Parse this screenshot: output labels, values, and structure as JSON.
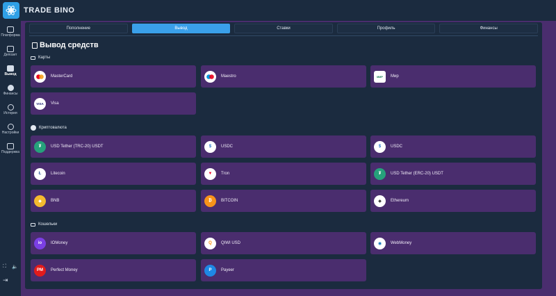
{
  "app": {
    "brand": "TRADE BINO"
  },
  "sidebar": {
    "items": [
      {
        "label": "Платформа"
      },
      {
        "label": "Депозит"
      },
      {
        "label": "Вывод"
      },
      {
        "label": "Финансы"
      },
      {
        "label": "История"
      },
      {
        "label": "Настройки"
      },
      {
        "label": "Поддержка"
      }
    ]
  },
  "tabs": [
    {
      "label": "Пополнение"
    },
    {
      "label": "Вывод"
    },
    {
      "label": "Ставки"
    },
    {
      "label": "Профиль"
    },
    {
      "label": "Финансы"
    }
  ],
  "page": {
    "title": "Вывод средств"
  },
  "sections": {
    "cards": {
      "title": "Карты",
      "items": [
        {
          "label": "MasterCard",
          "icon": "mastercard-icon"
        },
        {
          "label": "Maestro",
          "icon": "maestro-icon"
        },
        {
          "label": "Мир",
          "icon": "mir-icon"
        },
        {
          "label": "Visa",
          "icon": "visa-icon"
        }
      ]
    },
    "crypto": {
      "title": "Криптовалюта",
      "items": [
        {
          "label": "USD Tether (TRC-20) USDT",
          "icon": "tether-trc20-icon"
        },
        {
          "label": "USDC",
          "icon": "usdc-icon"
        },
        {
          "label": "USDC",
          "icon": "usdc-icon"
        },
        {
          "label": "Litecoin",
          "icon": "litecoin-icon"
        },
        {
          "label": "Tron",
          "icon": "tron-icon"
        },
        {
          "label": "USD Tether (ERC-20) USDT",
          "icon": "tether-erc20-icon"
        },
        {
          "label": "BNB",
          "icon": "bnb-icon"
        },
        {
          "label": "BITCOIN",
          "icon": "bitcoin-icon"
        },
        {
          "label": "Ethereum",
          "icon": "ethereum-icon"
        }
      ]
    },
    "wallets": {
      "title": "Кошельки",
      "items": [
        {
          "label": "IOMoney",
          "icon": "iomoney-icon"
        },
        {
          "label": "QIWI USD",
          "icon": "qiwi-icon"
        },
        {
          "label": "WebMoney",
          "icon": "webmoney-icon"
        },
        {
          "label": "Perfect Money",
          "icon": "perfect-money-icon"
        },
        {
          "label": "Payeer",
          "icon": "payeer-icon"
        }
      ]
    }
  },
  "colors": {
    "accent": "#3aa0ea",
    "card": "#4a2d6e",
    "panel": "#1b2b3f"
  }
}
